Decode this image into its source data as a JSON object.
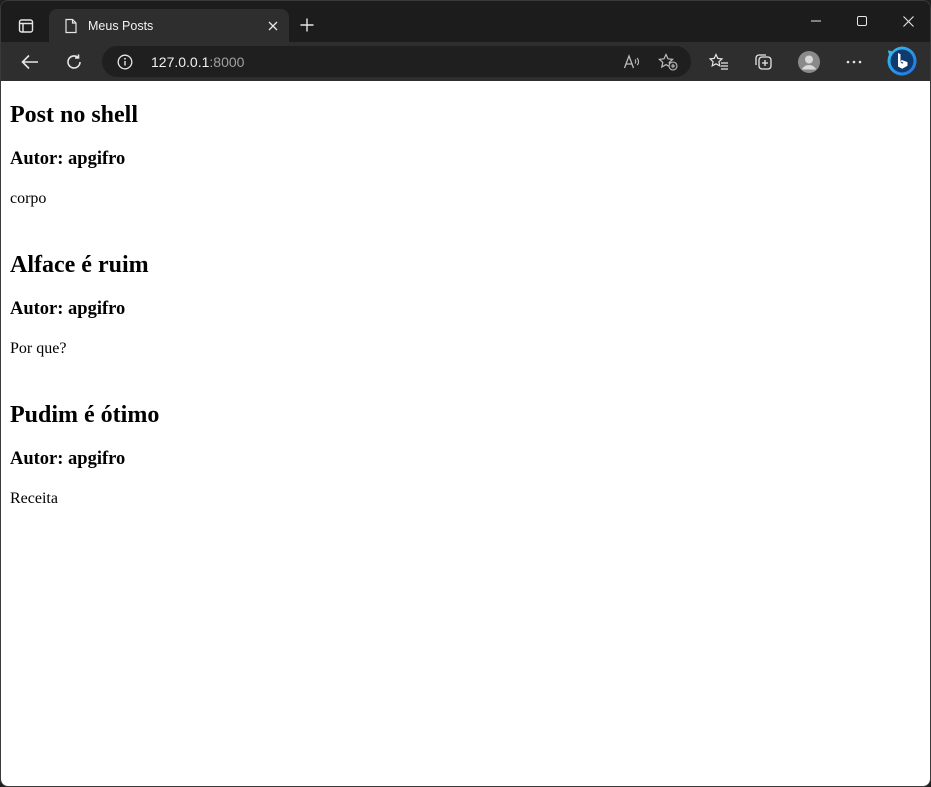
{
  "browser": {
    "tab": {
      "title": "Meus Posts"
    },
    "address": {
      "host": "127.0.0.1",
      "port": ":8000"
    },
    "icons": {
      "tab_actions": "tab-actions-icon",
      "favicon": "page-icon",
      "close": "close-icon",
      "new_tab": "plus-icon",
      "minimize": "minimize-icon",
      "maximize": "maximize-icon",
      "back": "back-arrow-icon",
      "refresh": "refresh-icon",
      "info": "info-icon",
      "read_aloud": "read-aloud-icon",
      "add_favorite": "add-favorite-icon",
      "favorites": "favorites-icon",
      "collections": "collections-icon",
      "profile": "profile-icon",
      "more": "more-icon",
      "bing": "bing-icon"
    }
  },
  "posts": [
    {
      "title": "Post no shell",
      "author": "Autor: apgifro",
      "body": "corpo"
    },
    {
      "title": "Alface é ruim",
      "author": "Autor: apgifro",
      "body": "Por que?"
    },
    {
      "title": "Pudim é ótimo",
      "author": "Autor: apgifro",
      "body": "Receita"
    }
  ]
}
